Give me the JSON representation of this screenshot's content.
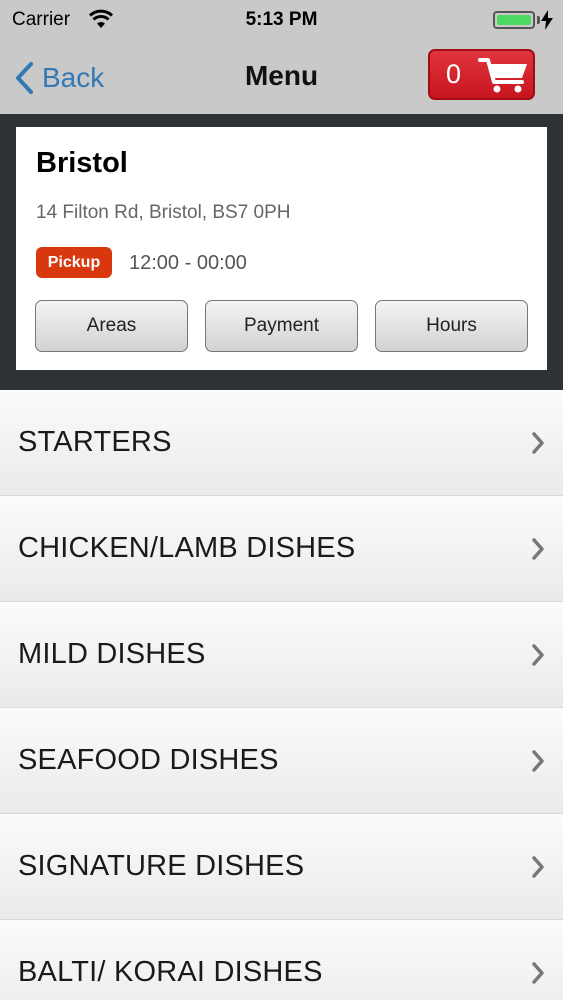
{
  "status_bar": {
    "carrier": "Carrier",
    "time": "5:13 PM",
    "wifi_icon": "wifi-icon",
    "battery_icon": "battery-icon",
    "charging_icon": "bolt-icon"
  },
  "nav": {
    "back_label": "Back",
    "title": "Menu",
    "cart_count": "0",
    "cart_icon": "cart-icon"
  },
  "store": {
    "name": "Bristol",
    "address": "14 Filton Rd, Bristol, BS7 0PH",
    "badge": "Pickup",
    "hours": "12:00 - 00:00",
    "buttons": [
      "Areas",
      "Payment",
      "Hours"
    ]
  },
  "menu": [
    {
      "label": "STARTERS"
    },
    {
      "label": "CHICKEN/LAMB DISHES"
    },
    {
      "label": "MILD DISHES"
    },
    {
      "label": "SEAFOOD DISHES"
    },
    {
      "label": "SIGNATURE DISHES"
    },
    {
      "label": "BALTI/ KORAI DISHES"
    }
  ],
  "colors": {
    "nav_background": "#c9c9c9",
    "back_blue": "#3478b6",
    "cart_red": "#d21f28",
    "badge_orange": "#d9380f",
    "info_background": "#2f3235"
  }
}
